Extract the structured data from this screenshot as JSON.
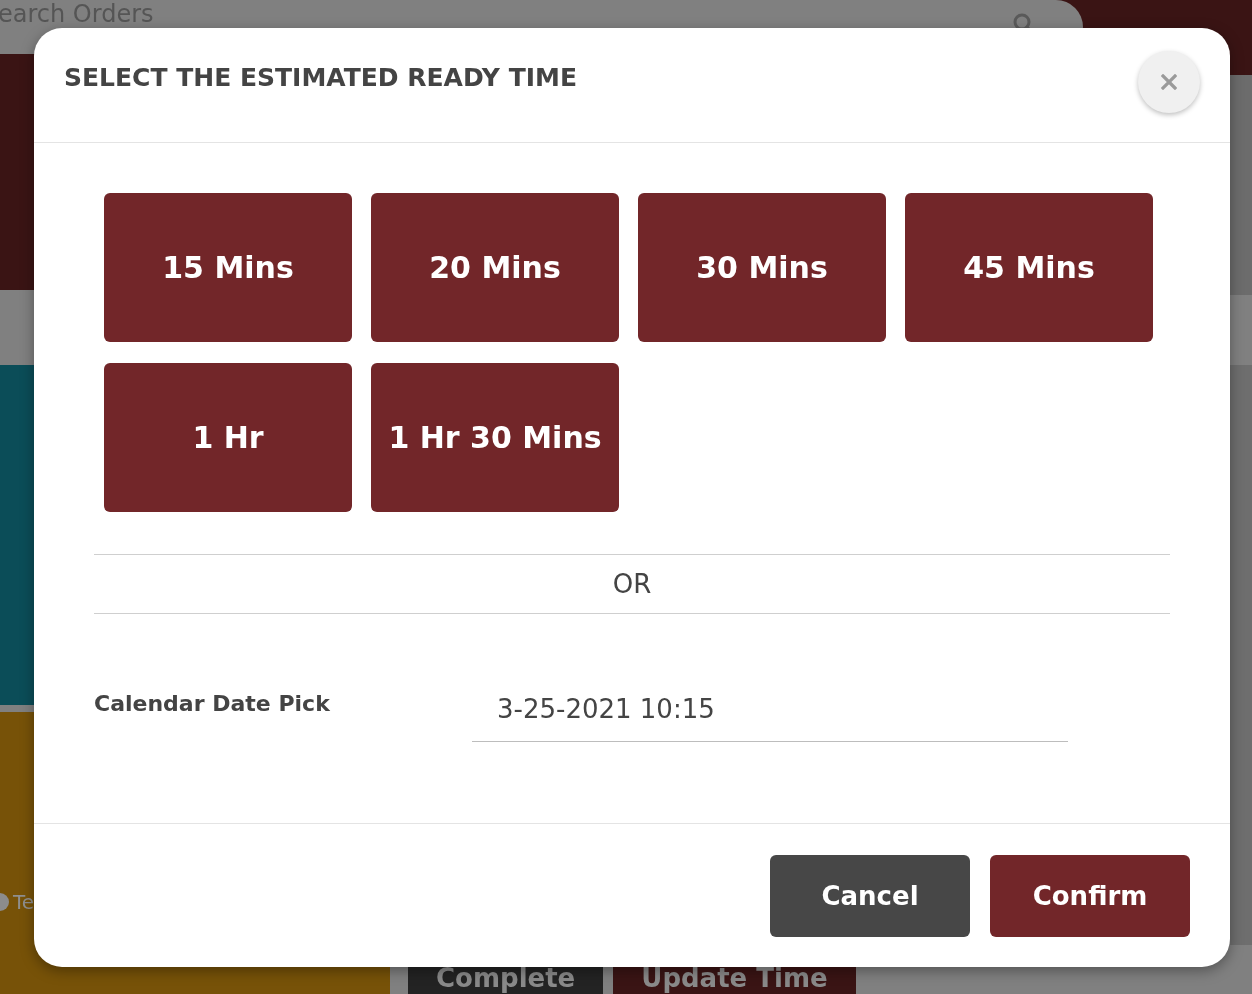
{
  "background": {
    "search_field": {
      "placeholder": "earch Orders"
    },
    "order_card_text": "Te",
    "action_buttons": [
      {
        "label": "Complete",
        "kind": "dark"
      },
      {
        "label": "Update Time",
        "kind": "primary"
      }
    ]
  },
  "dialog": {
    "title": "SELECT THE ESTIMATED READY TIME",
    "time_options": [
      {
        "label": "15 Mins",
        "selected": false
      },
      {
        "label": "20 Mins",
        "selected": false
      },
      {
        "label": "30 Mins",
        "selected": false
      },
      {
        "label": "45 Mins",
        "selected": false
      },
      {
        "label": "1 Hr",
        "selected": false
      },
      {
        "label": "1 Hr 30 Mins",
        "selected": false
      }
    ],
    "separator": "OR",
    "date_field": {
      "label": "Calendar Date Pick",
      "value": "3-25-2021 10:15"
    },
    "buttons": [
      {
        "label": "Cancel",
        "kind": "secondary"
      },
      {
        "label": "Confirm",
        "kind": "primary"
      }
    ]
  }
}
